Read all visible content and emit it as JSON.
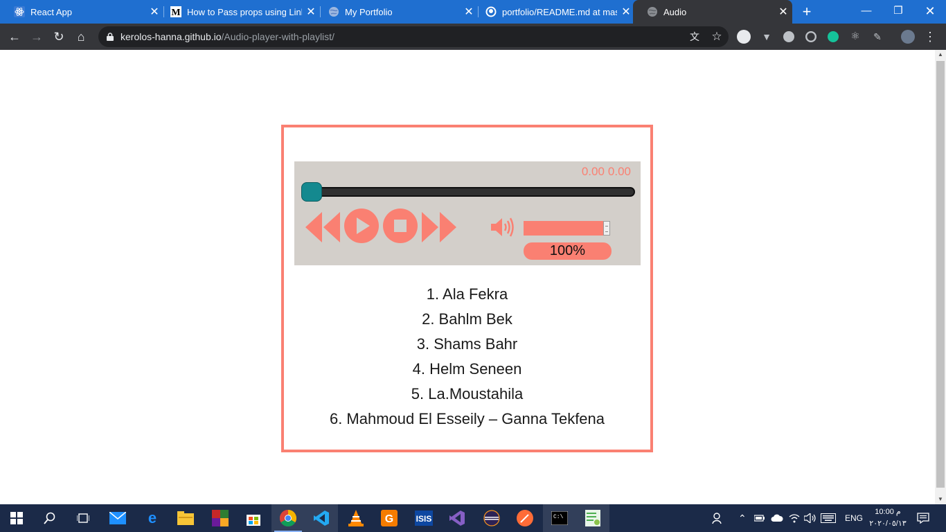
{
  "browser": {
    "tabs": [
      {
        "title": "React App",
        "icon": "react-icon",
        "active": false
      },
      {
        "title": "How to Pass props using Link a",
        "icon": "medium-icon",
        "active": false
      },
      {
        "title": "My Portfolio",
        "icon": "globe-icon",
        "active": false
      },
      {
        "title": "portfolio/README.md at maste",
        "icon": "github-icon",
        "active": false
      },
      {
        "title": "Audio",
        "icon": "globe-icon",
        "active": true
      }
    ],
    "url_host": "kerolos-hanna.github.io",
    "url_path": "/Audio-player-with-playlist/"
  },
  "player": {
    "current_time": "0.00",
    "duration": "0.00",
    "progress": 0,
    "volume_label": "100%",
    "volume": 1.0,
    "controls": [
      "rewind-icon",
      "play-icon",
      "stop-icon",
      "fast-forward-icon"
    ],
    "accent_color": "#fa8072",
    "panel_color": "#d3cfca",
    "thumb_color": "#14898f"
  },
  "playlist": [
    {
      "label": "1. Ala Fekra"
    },
    {
      "label": "2. Bahlm Bek"
    },
    {
      "label": "3. Shams Bahr"
    },
    {
      "label": "4. Helm Seneen"
    },
    {
      "label": "5. La.Moustahila"
    },
    {
      "label": "6. Mahmoud El Esseily – Ganna Tekfena"
    }
  ],
  "taskbar": {
    "language": "ENG",
    "time": "10:00 م",
    "date": "٢٠٢٠/٠٥/١٣"
  }
}
